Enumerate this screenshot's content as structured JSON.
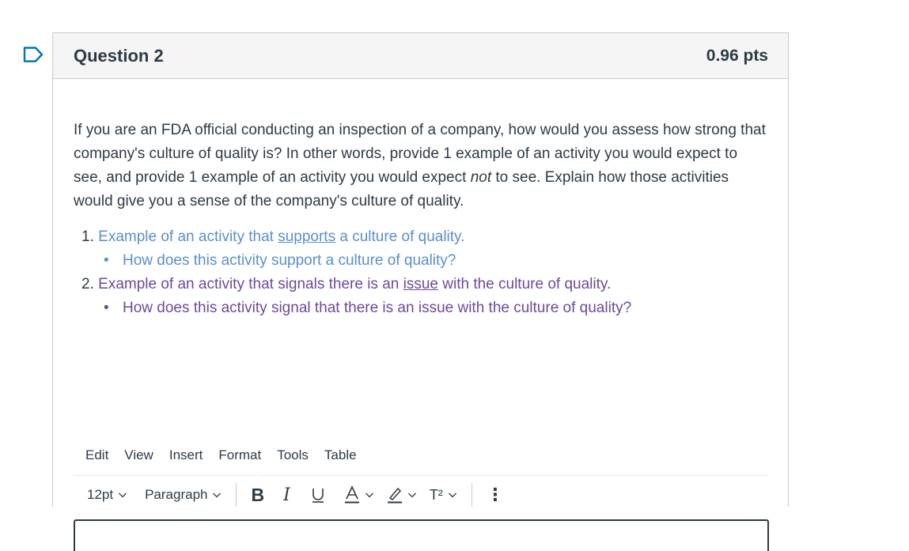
{
  "question": {
    "title": "Question 2",
    "points": "0.96 pts",
    "prompt_part1": "If you are an FDA official conducting an inspection of a company, how would you assess how strong that company's culture of quality is?  In other words, provide 1 example of an activity you would expect to see, and provide 1 example of an activity you would expect ",
    "prompt_italic": "not",
    "prompt_part2": " to see.  Explain how those activities would give you a sense of the company's culture of quality.",
    "items": [
      {
        "number": "1.",
        "text_before": "Example of an activity that ",
        "text_underlined": "supports",
        "text_after": " a culture of quality.",
        "sub": "How does this activity support a culture of quality?"
      },
      {
        "number": "2.",
        "text_before": "Example of an activity that signals there is an ",
        "text_underlined": "issue",
        "text_after": " with the culture of quality.",
        "sub": "How does this activity signal that there is an issue with the culture of quality?"
      }
    ]
  },
  "editor": {
    "menu": [
      "Edit",
      "View",
      "Insert",
      "Format",
      "Tools",
      "Table"
    ],
    "font_size": "12pt",
    "block_format": "Paragraph",
    "bold_label": "B",
    "italic_label": "I",
    "underline_label": "U",
    "text_color_label": "A",
    "superscript_label": "T²",
    "more_label": "⋮",
    "value": ""
  },
  "colors": {
    "link_blue": "#5b8fc9",
    "link_purple": "#6e4a98",
    "text": "#2d3b45",
    "header_bg": "#f5f5f5",
    "flag": "#0374b5"
  },
  "icons": [
    "flag-question-icon",
    "chevron-down-icon",
    "bold-icon",
    "italic-icon",
    "underline-icon",
    "text-color-icon",
    "highlight-icon",
    "superscript-icon",
    "more-icon"
  ]
}
